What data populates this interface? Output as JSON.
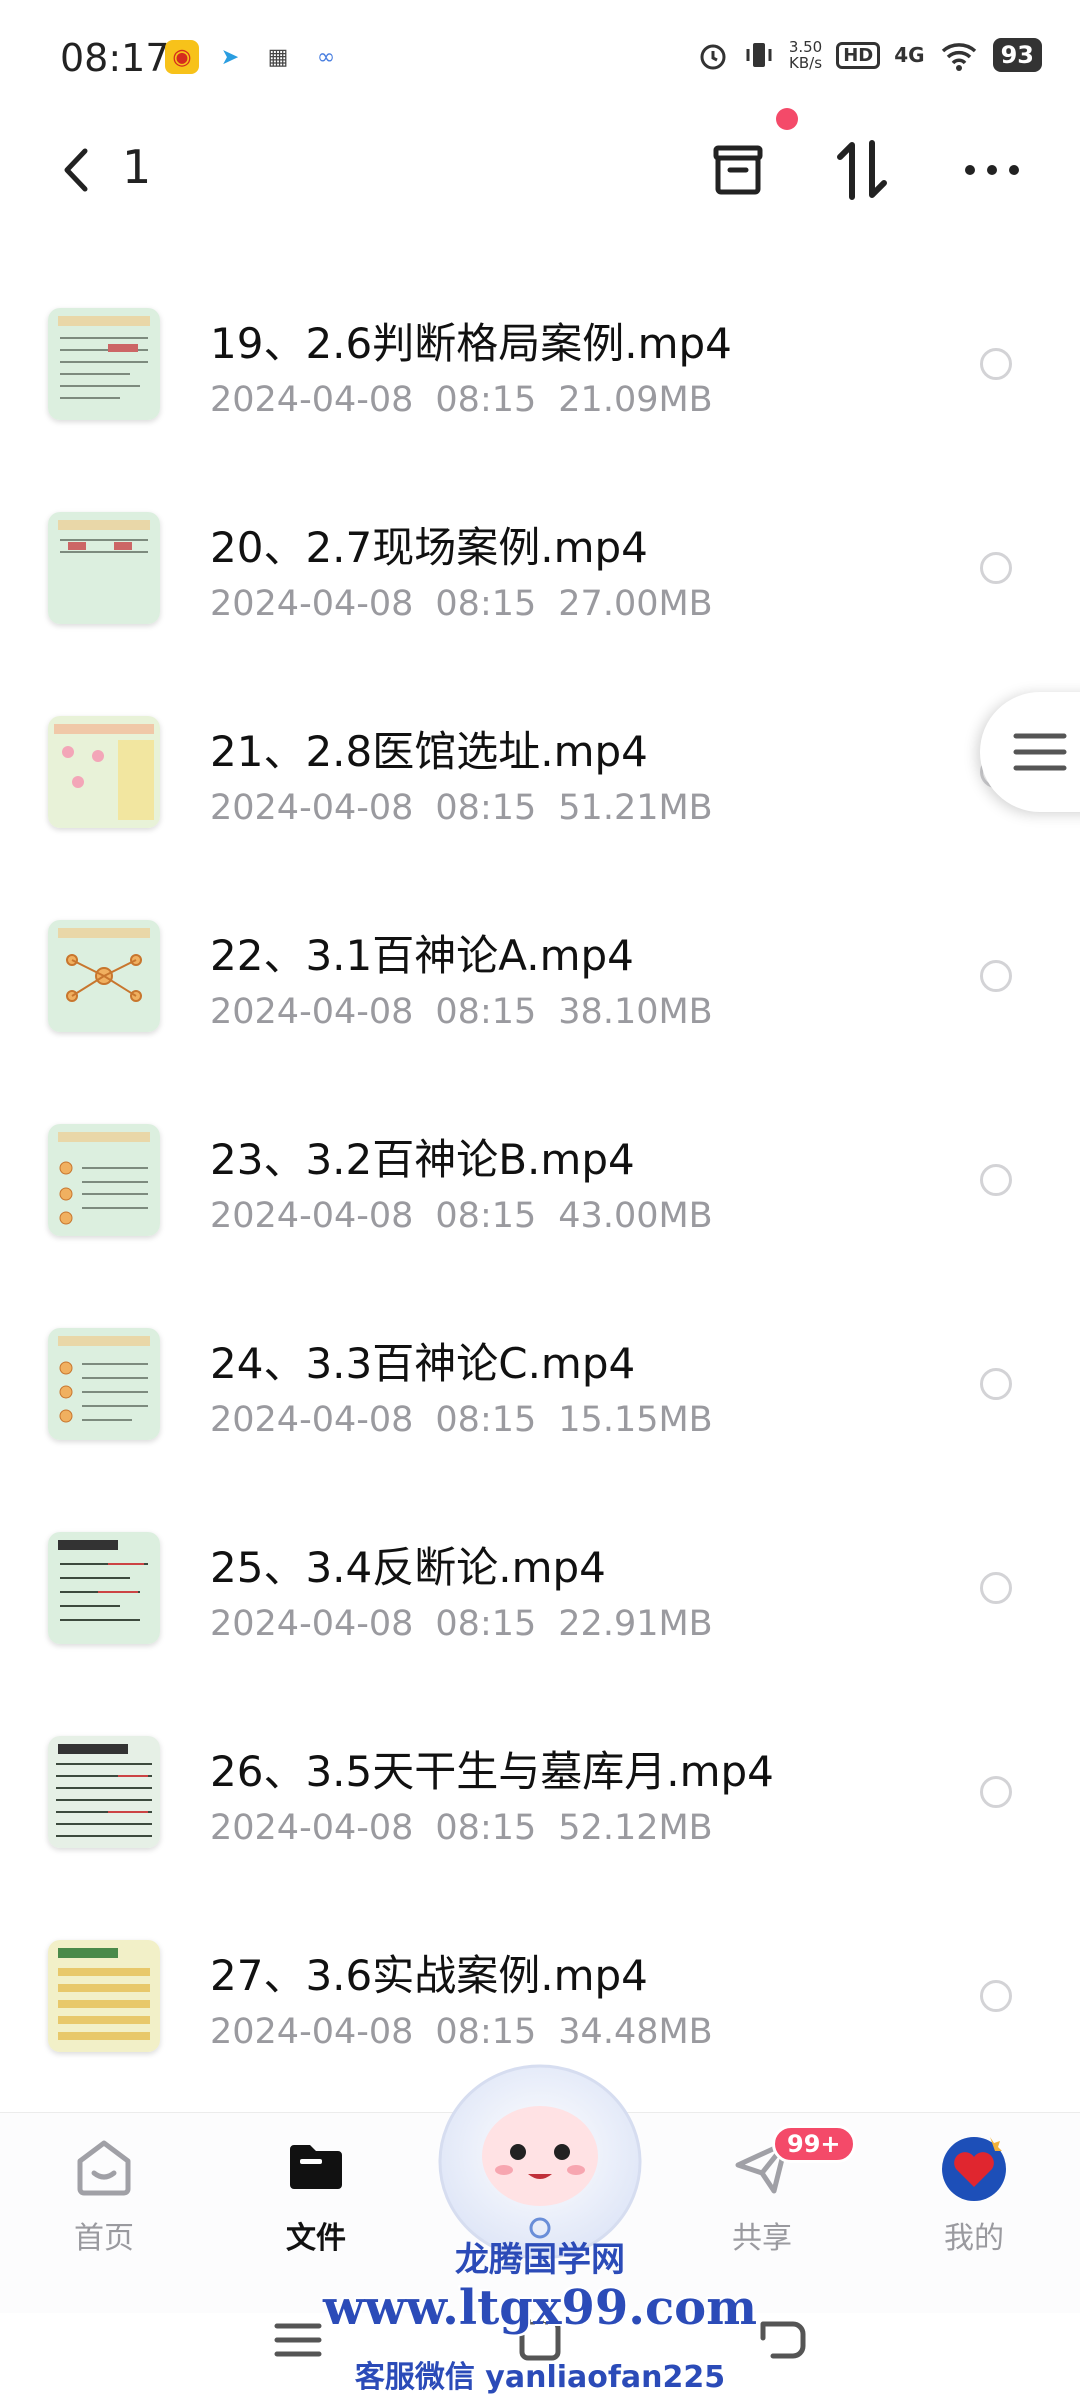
{
  "status_bar": {
    "time": "08:17",
    "net_speed_value": "3.50",
    "net_speed_unit": "KB/s",
    "hd_label": "HD",
    "signal_label": "4G",
    "battery": "93"
  },
  "top_bar": {
    "title": "1"
  },
  "files": [
    {
      "name": "19、2.6判断格局案例.mp4",
      "date": "2024-04-08",
      "time": "08:15",
      "size": "21.09MB"
    },
    {
      "name": "20、2.7现场案例.mp4",
      "date": "2024-04-08",
      "time": "08:15",
      "size": "27.00MB"
    },
    {
      "name": "21、2.8医馆选址.mp4",
      "date": "2024-04-08",
      "time": "08:15",
      "size": "51.21MB"
    },
    {
      "name": "22、3.1百神论A.mp4",
      "date": "2024-04-08",
      "time": "08:15",
      "size": "38.10MB"
    },
    {
      "name": "23、3.2百神论B.mp4",
      "date": "2024-04-08",
      "time": "08:15",
      "size": "43.00MB"
    },
    {
      "name": "24、3.3百神论C.mp4",
      "date": "2024-04-08",
      "time": "08:15",
      "size": "15.15MB"
    },
    {
      "name": "25、3.4反断论.mp4",
      "date": "2024-04-08",
      "time": "08:15",
      "size": "22.91MB"
    },
    {
      "name": "26、3.5天干生与墓库月.mp4",
      "date": "2024-04-08",
      "time": "08:15",
      "size": "52.12MB"
    },
    {
      "name": "27、3.6实战案例.mp4",
      "date": "2024-04-08",
      "time": "08:15",
      "size": "34.48MB"
    }
  ],
  "bottom_nav": {
    "home": "首页",
    "files": "文件",
    "share": "共享",
    "share_badge": "99+",
    "me": "我的"
  },
  "watermark": {
    "line1": "龙腾国学网",
    "line2": "www.ltgx99.com",
    "line3": "客服微信 yanliaofan225"
  },
  "colors": {
    "accent": "#f44a69",
    "meta_text": "#9a9a9f",
    "thumb_bg": "#dfeee0",
    "watermark": "#2b4bb8"
  }
}
